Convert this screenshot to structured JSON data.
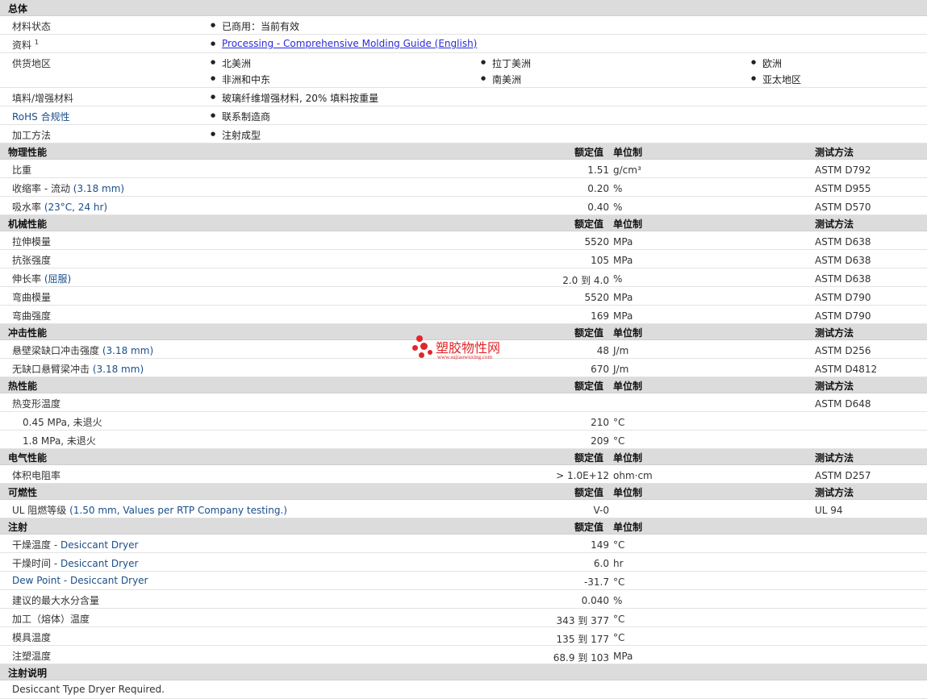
{
  "sections": [
    {
      "title": "总体",
      "general": true,
      "rows": [
        {
          "label": "材料状态",
          "items": [
            [
              "已商用：当前有效"
            ]
          ]
        },
        {
          "label": "资料",
          "sup": "1",
          "items": [
            [
              "Processing - Comprehensive Molding Guide (English)"
            ]
          ],
          "link": true
        },
        {
          "label": "供货地区",
          "items": [
            [
              "北美洲",
              "拉丁美洲",
              "欧洲"
            ],
            [
              "非洲和中东",
              "南美洲",
              "亚太地区"
            ]
          ]
        },
        {
          "label": "填料/增强材料",
          "items": [
            [
              "玻璃纤维增强材料, 20% 填料按重量"
            ]
          ]
        },
        {
          "label": "RoHS 合规性",
          "items": [
            [
              "联系制造商"
            ]
          ],
          "labelColor": "blue"
        },
        {
          "label": "加工方法",
          "items": [
            [
              "注射成型"
            ]
          ]
        }
      ]
    },
    {
      "title": "物理性能",
      "nominal": "额定值",
      "unit": "单位制",
      "method": "测试方法",
      "rows": [
        {
          "label": "比重",
          "value": "1.51",
          "unit": "g/cm³",
          "method": "ASTM D792"
        },
        {
          "label": "收缩率 - 流动",
          "cond": "(3.18 mm)",
          "value": "0.20",
          "unit": "%",
          "method": "ASTM D955"
        },
        {
          "label": "吸水率",
          "cond": "(23°C, 24 hr)",
          "value": "0.40",
          "unit": "%",
          "method": "ASTM D570"
        }
      ]
    },
    {
      "title": "机械性能",
      "nominal": "额定值",
      "unit": "单位制",
      "method": "测试方法",
      "rows": [
        {
          "label": "拉伸模量",
          "value": "5520",
          "unit": "MPa",
          "method": "ASTM D638"
        },
        {
          "label": "抗张强度",
          "value": "105",
          "unit": "MPa",
          "method": "ASTM D638"
        },
        {
          "label": "伸长率",
          "cond": "(屈服)",
          "value": "2.0 到  4.0",
          "unit": "%",
          "method": "ASTM D638"
        },
        {
          "label": "弯曲模量",
          "value": "5520",
          "unit": "MPa",
          "method": "ASTM D790"
        },
        {
          "label": "弯曲强度",
          "value": "169",
          "unit": "MPa",
          "method": "ASTM D790"
        }
      ]
    },
    {
      "title": "冲击性能",
      "nominal": "额定值",
      "unit": "单位制",
      "method": "测试方法",
      "rows": [
        {
          "label": "悬壁梁缺口冲击强度",
          "cond": "(3.18 mm)",
          "value": "48",
          "unit": "J/m",
          "method": "ASTM D256"
        },
        {
          "label": "无缺口悬臂梁冲击",
          "cond": "(3.18 mm)",
          "value": "670",
          "unit": "J/m",
          "method": "ASTM D4812"
        }
      ]
    },
    {
      "title": "热性能",
      "nominal": "额定值",
      "unit": "单位制",
      "method": "测试方法",
      "rows": [
        {
          "label": "热变形温度",
          "value": "",
          "unit": "",
          "method": "ASTM D648"
        },
        {
          "label": "0.45 MPa, 未退火",
          "sub": true,
          "value": "210",
          "unit": "°C",
          "method": ""
        },
        {
          "label": "1.8 MPa, 未退火",
          "sub": true,
          "value": "209",
          "unit": "°C",
          "method": ""
        }
      ]
    },
    {
      "title": "电气性能",
      "nominal": "额定值",
      "unit": "单位制",
      "method": "测试方法",
      "rows": [
        {
          "label": "体积电阻率",
          "value": "> 1.0E+12",
          "unit": "ohm·cm",
          "method": "ASTM D257"
        }
      ]
    },
    {
      "title": "可燃性",
      "nominal": "额定值",
      "unit": "单位制",
      "method": "测试方法",
      "rows": [
        {
          "label": "UL 阻燃等级",
          "cond": "(1.50 mm, Values per RTP Company testing.)",
          "value": "V-0",
          "unit": "",
          "method": "UL 94"
        }
      ]
    },
    {
      "title": "注射",
      "nominal": "额定值",
      "unit": "单位制",
      "rows": [
        {
          "label": "干燥温度",
          "cond": " - Desiccant Dryer",
          "value": "149",
          "unit": "°C"
        },
        {
          "label": "干燥时间",
          "cond": " - Desiccant Dryer",
          "value": "6.0",
          "unit": "hr"
        },
        {
          "label": "Dew Point - Desiccant Dryer",
          "labelColor": "blue",
          "value": "-31.7",
          "unit": "°C"
        },
        {
          "label": "建议的最大水分含量",
          "value": "0.040",
          "unit": "%"
        },
        {
          "label": "加工（熔体）温度",
          "value": "343 到  377",
          "unit": "°C"
        },
        {
          "label": "模具温度",
          "value": "135 到  177",
          "unit": "°C"
        },
        {
          "label": "注塑温度",
          "value": "68.9 到  103",
          "unit": "MPa"
        }
      ]
    },
    {
      "title": "注射说明",
      "rows": [
        {
          "label": "Desiccant Type Dryer Required.",
          "note": true
        }
      ]
    }
  ],
  "watermark": {
    "text": "塑胶物性网",
    "url": "www.sujiaowuxing.com"
  },
  "colors": {
    "header_bg": "#dcdcdc",
    "label_blue": "#1a4e8a",
    "link": "#2b2bd8",
    "watermark": "#e0272b"
  }
}
